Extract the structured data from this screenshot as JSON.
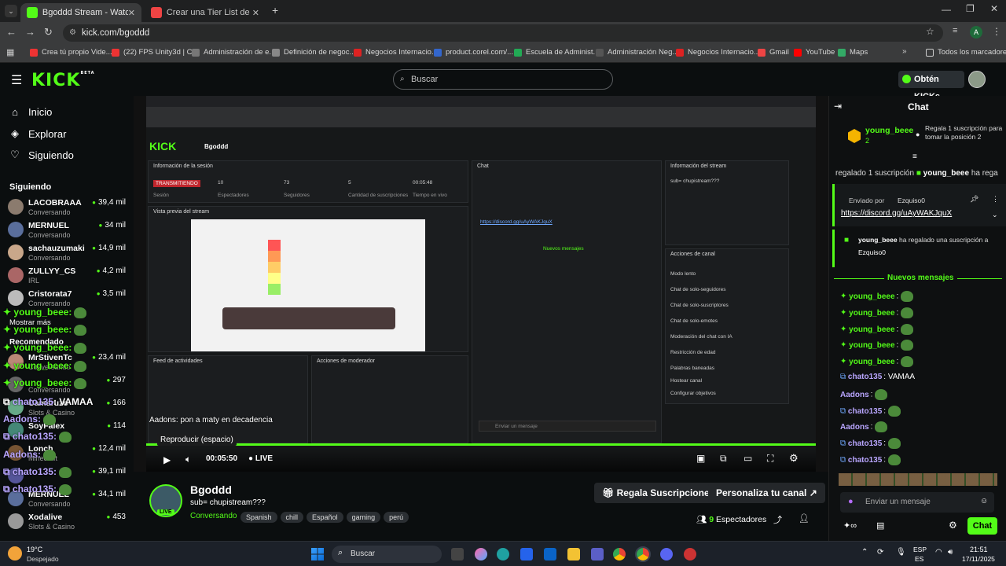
{
  "browser": {
    "tabs": [
      {
        "title": "Bgoddd Stream - Watch Live on",
        "active": true
      },
      {
        "title": "Crear una Tier List de elmodre",
        "active": false
      }
    ],
    "url": "kick.com/bgoddd",
    "bookmarks": [
      "Crea tú propio Vide...",
      "(22) FPS Unity3d | C...",
      "Administración de e...",
      "Definición de negoc...",
      "Negocios Internacio...",
      "product.corel.com/...",
      "Escuela de Administ...",
      "Administración Neg...",
      "Negocios Internacio...",
      "Gmail",
      "YouTube",
      "Maps"
    ],
    "bookmarks_folder": "Todos los marcadores"
  },
  "header": {
    "logo": "KICK",
    "logo_badge": "BETA",
    "search_placeholder": "Buscar",
    "get_kicks": "Obtén KICKs"
  },
  "sidebar": {
    "nav": [
      {
        "label": "Inicio",
        "icon": "home-icon"
      },
      {
        "label": "Explorar",
        "icon": "compass-icon"
      },
      {
        "label": "Siguiendo",
        "icon": "heart-icon"
      }
    ],
    "following_title": "Siguiendo",
    "following": [
      {
        "name": "LACOBRAAA",
        "category": "Conversando",
        "viewers": "39,4 mil"
      },
      {
        "name": "MERNUEL",
        "category": "Conversando",
        "viewers": "34 mil"
      },
      {
        "name": "sachauzumaki",
        "category": "Conversando",
        "viewers": "14,9 mil"
      },
      {
        "name": "ZULLYY_CS",
        "category": "IRL",
        "viewers": "4,2 mil"
      },
      {
        "name": "Cristorata7",
        "category": "Conversando",
        "viewers": "3,5 mil"
      }
    ],
    "show_more": "Mostrar más",
    "recommended_title": "Recomendado",
    "recommended": [
      {
        "name": "MrStivenTc",
        "category": "Conversando",
        "viewers": "23,4 mil"
      },
      {
        "name": "",
        "category": "Conversando",
        "viewers": "297"
      },
      {
        "name": "Camaruzo",
        "category": "Slots & Casino",
        "viewers": "166"
      },
      {
        "name": "SoyFalex",
        "category": "",
        "viewers": "114"
      },
      {
        "name": "Lonch",
        "category": "Minecraft",
        "viewers": "12,4 mil"
      },
      {
        "name": "",
        "category": "",
        "viewers": "39,1 mil"
      },
      {
        "name": "MERNUEL",
        "category": "Conversando",
        "viewers": "34,1 mil"
      },
      {
        "name": "Xodalive",
        "category": "Slots & Casino",
        "viewers": "453"
      }
    ],
    "overlay_chat": [
      {
        "user": "young_beee",
        "text": ":"
      },
      {
        "user": "young_beee",
        "text": ":"
      },
      {
        "user": "young_beee",
        "text": ":"
      },
      {
        "user": "young_beee",
        "text": ":"
      },
      {
        "user": "young_beee",
        "text": ":"
      },
      {
        "user": "chato135",
        "text": ": VAMAA"
      },
      {
        "user": "Aadons",
        "text": ":"
      },
      {
        "user": "chato135",
        "text": ":"
      },
      {
        "user": "Aadons",
        "text": ":"
      },
      {
        "user": "chato135",
        "text": ":"
      },
      {
        "user": "chato135",
        "text": ":"
      }
    ]
  },
  "player": {
    "time": "00:05:50",
    "live": "LIVE",
    "tooltip": "Reproducir (espacio)",
    "caption": "Aadons: pon a maty en decadencia",
    "inner_dashboard": {
      "session_title": "Información de la sesión",
      "preview_title": "Vista previa del stream",
      "stats": [
        {
          "value": "TRANSMITIENDO",
          "label": "Sesión"
        },
        {
          "value": "10",
          "label": "Espectadores"
        },
        {
          "value": "73",
          "label": "Seguidores"
        },
        {
          "value": "5",
          "label": "Cantidad de suscripciones"
        },
        {
          "value": "00:05:48",
          "label": "Tiempo en vivo"
        }
      ],
      "chat_title": "Chat",
      "stream_info_title": "Información del stream",
      "stream_sub": "sub= chupistream???",
      "feed_title": "Feed de actividades",
      "mod_title": "Acciones de moderador",
      "channel_actions_title": "Acciones de canal",
      "channel_actions": [
        "Modo lento",
        "Chat de solo-seguidores",
        "Chat de solo-suscriptores",
        "Chat de solo-emotes",
        "Moderación del chat con IA",
        "Restricción de edad",
        "Palabras baneadas",
        "Hostear canal",
        "Configurar objetivos"
      ],
      "new_messages": "Nuevos mensajes",
      "chat_input": "Enviar un mensaje"
    }
  },
  "stream": {
    "name": "Bgoddd",
    "title": "sub= chupistream???",
    "category": "Conversando",
    "tags": [
      "Spanish",
      "chill",
      "Español",
      "gaming",
      "perú"
    ],
    "live_badge": "LIVE",
    "gift_button": "Regala Suscripciones",
    "customize_button": "Personaliza tu canal",
    "viewers": "9",
    "viewers_label": "Espectadores"
  },
  "chat": {
    "title": "Chat",
    "pinned_user": "young_beee",
    "pinned_count": "2",
    "pinned_text": "Regala 1 suscripción para tomar la posición 2",
    "ticker": "regalado 1 suscripción",
    "ticker_user": "young_beee",
    "ticker_end": "ha rega",
    "sent_by": "Enviado por",
    "sent_by_user": "Ezquiso0",
    "pinned_link": "https://discord.gg/uAyWAKJquX",
    "gift_user": "young_beee",
    "gift_text": "ha regalado una suscripción a",
    "gift_recipient": "Ezquiso0",
    "new_messages": "Nuevos mensajes",
    "messages": [
      {
        "user": "young_beee",
        "text": ":",
        "color": "#53fc18"
      },
      {
        "user": "young_beee",
        "text": ":",
        "color": "#53fc18"
      },
      {
        "user": "young_beee",
        "text": ":",
        "color": "#53fc18"
      },
      {
        "user": "young_beee",
        "text": ":",
        "color": "#53fc18"
      },
      {
        "user": "young_beee",
        "text": ":",
        "color": "#53fc18"
      },
      {
        "user": "chato135",
        "text": ": VAMAA",
        "color": "#b9a6ff"
      },
      {
        "user": "Aadons",
        "text": ":",
        "color": "#b9a6ff"
      },
      {
        "user": "chato135",
        "text": ":",
        "color": "#b9a6ff"
      },
      {
        "user": "Aadons",
        "text": ":",
        "color": "#b9a6ff"
      },
      {
        "user": "chato135",
        "text": ":",
        "color": "#b9a6ff"
      },
      {
        "user": "chato135",
        "text": ":",
        "color": "#b9a6ff"
      }
    ],
    "input_placeholder": "Enviar un mensaje",
    "send_button": "Chat"
  },
  "taskbar": {
    "weather_temp": "19°C",
    "weather_desc": "Despejado",
    "search": "Buscar",
    "lang1": "ESP",
    "lang2": "ES",
    "time": "21:51",
    "date": "17/11/2025"
  },
  "colors": {
    "accent": "#53fc18",
    "background": "#0b0e0f",
    "chat_purple": "#b9a6ff"
  }
}
